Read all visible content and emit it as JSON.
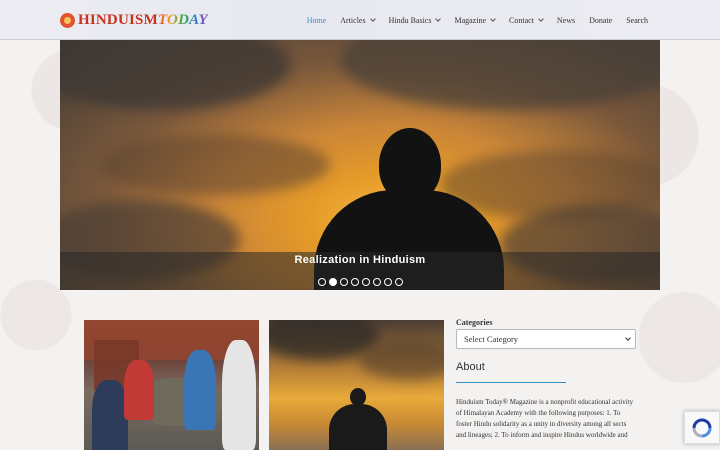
{
  "site": {
    "logo_word1": "HINDUISM",
    "logo_word2": "TODAY"
  },
  "nav": {
    "items": [
      {
        "label": "Home",
        "active": true,
        "dropdown": false
      },
      {
        "label": "Articles",
        "active": false,
        "dropdown": true
      },
      {
        "label": "Hindu Basics",
        "active": false,
        "dropdown": true
      },
      {
        "label": "Magazine",
        "active": false,
        "dropdown": true
      },
      {
        "label": "Contact",
        "active": false,
        "dropdown": true
      },
      {
        "label": "News",
        "active": false,
        "dropdown": false
      },
      {
        "label": "Donate",
        "active": false,
        "dropdown": false
      },
      {
        "label": "Search",
        "active": false,
        "dropdown": false
      }
    ]
  },
  "hero": {
    "caption": "Realization in Hinduism",
    "slide_count": 8,
    "active_slide": 2
  },
  "sidebar": {
    "categories_label": "Categories",
    "categories_select_value": "Select Category",
    "about_title": "About",
    "about_text": "Hinduism Today® Magazine is a nonprofit educational activity of Himalayan Academy with the following purposes: 1. To foster Hindu solidarity as a unity in diversity among all sects and lineages; 2. To inform and inspire Hindus worldwide and"
  },
  "colors": {
    "accent": "#2f8fc5",
    "logo_red": "#c8321e"
  },
  "icons": {
    "recaptcha": "recaptcha-icon",
    "nav_dropdown": "chevron-down-icon"
  }
}
